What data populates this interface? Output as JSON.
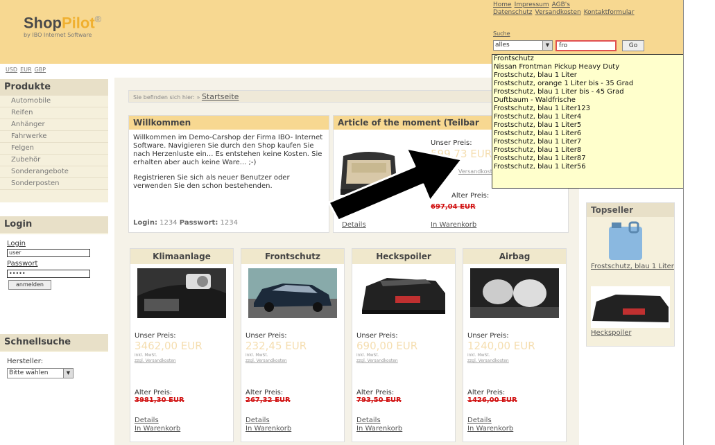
{
  "header": {
    "logo_shop": "Shop",
    "logo_pilot": "Pilot",
    "logo_reg": "®",
    "logo_sub": "by IBO Internet Software",
    "toplinks_row1": [
      "Home",
      "Impressum",
      "AGB's"
    ],
    "toplinks_row2": [
      "Datenschutz",
      "Versandkosten",
      "Kontaktformular"
    ]
  },
  "search": {
    "label": "Suche",
    "category_value": "alles",
    "query_value": "fro",
    "go_label": "Go",
    "suggestions": [
      "Frontschutz",
      "Nissan Frontman Pickup Heavy Duty",
      "Frostschutz, blau 1 Liter",
      "Frostschutz, orange 1 Liter bis - 35 Grad",
      "Frostschutz, blau 1 Liter bis - 45 Grad",
      "Duftbaum - Waldfrische",
      "Frostschutz, blau 1 Liter123",
      "Frostschutz, blau 1 Liter4",
      "Frostschutz, blau 1 Liter5",
      "Frostschutz, blau 1 Liter6",
      "Frostschutz, blau 1 Liter7",
      "Frostschutz, blau 1 Liter8",
      "Frostschutz, blau 1 Liter87",
      "Frostschutz, blau 1 Liter56"
    ]
  },
  "currencies": [
    "USD",
    "EUR",
    "GBP"
  ],
  "sidebar": {
    "produkte_title": "Produkte",
    "nav": [
      "Automobile",
      "Reifen",
      "Anhänger",
      "Fahrwerke",
      "Felgen",
      "Zubehör",
      "Sonderangebote",
      "Sonderposten"
    ],
    "login_title": "Login",
    "login_label": "Login",
    "login_value": "user",
    "password_label": "Passwort",
    "password_value": "•••••",
    "submit_label": "anmelden",
    "schnellsuche_title": "Schnellsuche",
    "hersteller_label": "Hersteller:",
    "hersteller_value": "Bitte wählen"
  },
  "breadcrumb": {
    "prefix": "Sie befinden sich hier: »",
    "link": "Startseite"
  },
  "welcome": {
    "title": "Willkommen",
    "text1": "Willkommen im Demo-Carshop der Firma IBO- Internet Software. Navigieren Sie durch den Shop kaufen Sie nach Herzenluste ein... Es entstehen keine Kosten. Sie erhalten aber auch keine Ware... ;-)",
    "text2": "Registrieren Sie sich als neuer Benutzer oder verwenden Sie den schon bestehenden.",
    "login_lbl": "Login:",
    "login_val": "1234",
    "pass_lbl": "Passwort:",
    "pass_val": "1234"
  },
  "moment": {
    "title": "Article of the moment (Teilbar",
    "unser_preis": "Unser Preis:",
    "price": "599,73 EUR",
    "small": "Versandkosten",
    "alter_preis": "Alter Preis:",
    "old_price": "697,04 EUR",
    "details": "Details",
    "cart": "In Warenkorb"
  },
  "products": [
    {
      "title": "Klimaanlage",
      "unser_lbl": "Unser Preis:",
      "price": "3462,00 EUR",
      "tax": "inkl. MwSt.",
      "ship": "zzgl. Versandkosten",
      "alt_lbl": "Alter Preis:",
      "old": "3981,30 EUR",
      "details": "Details",
      "cart": "In Warenkorb"
    },
    {
      "title": "Frontschutz",
      "unser_lbl": "Unser Preis:",
      "price": "232,45 EUR",
      "tax": "inkl. MwSt.",
      "ship": "zzgl. Versandkosten",
      "alt_lbl": "Alter Preis:",
      "old": "267,32 EUR",
      "details": "Details",
      "cart": "In Warenkorb"
    },
    {
      "title": "Heckspoiler",
      "unser_lbl": "Unser Preis:",
      "price": "690,00 EUR",
      "tax": "inkl. MwSt.",
      "ship": "zzgl. Versandkosten",
      "alt_lbl": "Alter Preis:",
      "old": "793,50 EUR",
      "details": "Details",
      "cart": "In Warenkorb"
    },
    {
      "title": "Airbag",
      "unser_lbl": "Unser Preis:",
      "price": "1240,00 EUR",
      "tax": "inkl. MwSt.",
      "ship": "zzgl. Versandkosten",
      "alt_lbl": "Alter Preis:",
      "old": "1426,00 EUR",
      "details": "Details",
      "cart": "In Warenkorb"
    }
  ],
  "topseller": {
    "title": "Topseller",
    "item1": "Frostschutz, blau 1 Liter",
    "item2": "Heckspoiler"
  },
  "colors": {
    "header_bg": "#f7d891",
    "price_light": "#f5deb0",
    "old_price_red": "#d01010",
    "dropdown_bg": "#ffffcc",
    "search_border": "#e05050"
  },
  "icons": {
    "annotation": "black-arrow-icon"
  }
}
